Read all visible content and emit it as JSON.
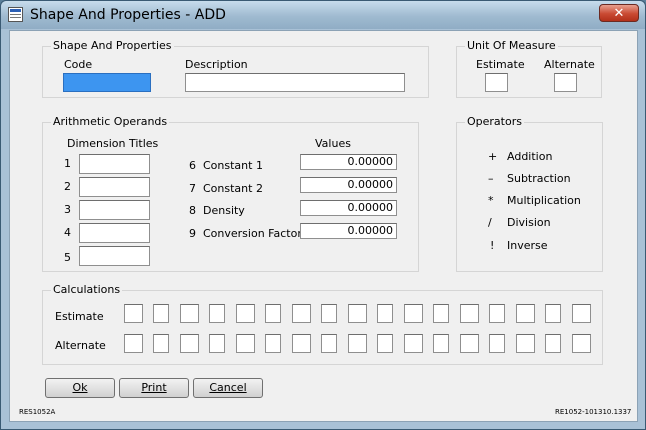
{
  "window": {
    "title": "Shape And Properties - ADD",
    "close_label": "✕"
  },
  "shape_group": {
    "title": "Shape And Properties",
    "code_label": "Code",
    "code_value": "",
    "description_label": "Description",
    "description_value": ""
  },
  "unit_group": {
    "title": "Unit Of Measure",
    "estimate_label": "Estimate",
    "estimate_value": "",
    "alternate_label": "Alternate",
    "alternate_value": ""
  },
  "operands_group": {
    "title": "Arithmetic Operands",
    "dimension_titles_label": "Dimension Titles",
    "values_label": "Values",
    "dimensions": [
      {
        "num": "1",
        "value": ""
      },
      {
        "num": "2",
        "value": ""
      },
      {
        "num": "3",
        "value": ""
      },
      {
        "num": "4",
        "value": ""
      },
      {
        "num": "5",
        "value": ""
      }
    ],
    "constants": [
      {
        "num": "6",
        "label": "Constant 1",
        "value": "0.00000"
      },
      {
        "num": "7",
        "label": "Constant 2",
        "value": "0.00000"
      },
      {
        "num": "8",
        "label": "Density",
        "value": "0.00000"
      },
      {
        "num": "9",
        "label": "Conversion Factor",
        "value": "0.00000"
      }
    ]
  },
  "operators_group": {
    "title": "Operators",
    "items": [
      {
        "symbol": "+",
        "label": "Addition"
      },
      {
        "symbol": "–",
        "label": "Subtraction"
      },
      {
        "symbol": "*",
        "label": "Multiplication"
      },
      {
        "symbol": "/",
        "label": "Division"
      },
      {
        "symbol": "!",
        "label": "Inverse"
      }
    ]
  },
  "calculations_group": {
    "title": "Calculations",
    "estimate_label": "Estimate",
    "alternate_label": "Alternate"
  },
  "buttons": {
    "ok": "Ok",
    "print": "Print",
    "cancel": "Cancel"
  },
  "footer": {
    "left": "RES1052A",
    "right": "RE1052-101310.1337"
  }
}
